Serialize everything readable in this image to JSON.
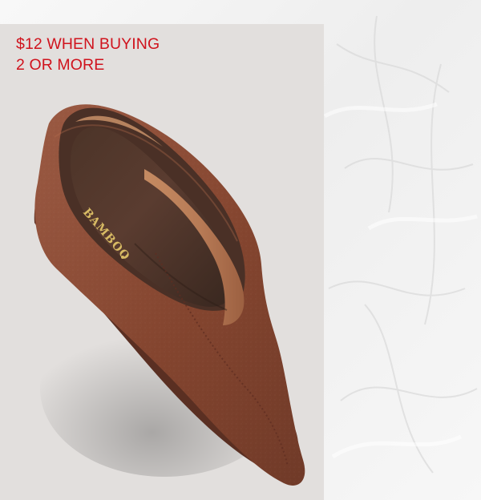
{
  "promo": {
    "line1": "$12 WHEN BUYING",
    "line2": "2 OR MORE",
    "color": "#d0131d"
  },
  "product": {
    "image_subject": "brown suede pointed-toe flat shoe",
    "insole_brand": "BAMBOO"
  },
  "colors": {
    "card_background": "#e2dfdd",
    "page_background": "#f3f3f3",
    "suede": "#8a4b38"
  }
}
